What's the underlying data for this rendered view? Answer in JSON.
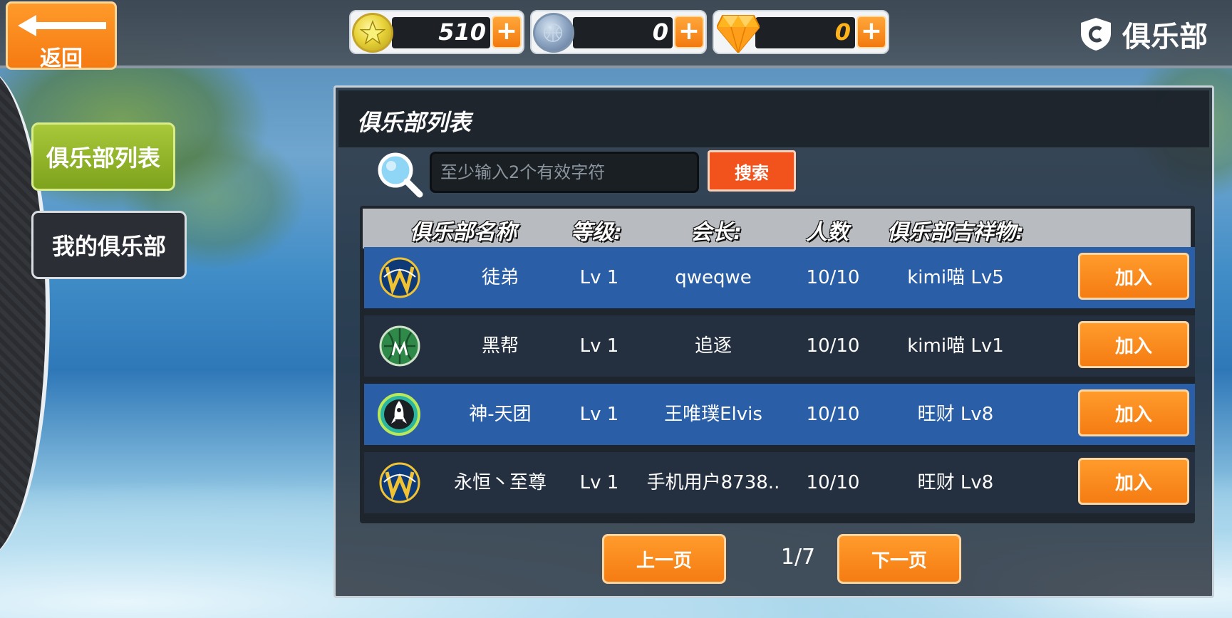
{
  "header": {
    "back_label": "返回",
    "title": "俱乐部",
    "currencies": [
      {
        "type": "gold-coin",
        "value": "510"
      },
      {
        "type": "silver-coin",
        "value": "0"
      },
      {
        "type": "diamond",
        "value": "0"
      }
    ],
    "plus_label": "+"
  },
  "sidebar": {
    "items": [
      {
        "label": "俱乐部列表",
        "active": true
      },
      {
        "label": "我的俱乐部",
        "active": false
      }
    ]
  },
  "panel": {
    "title": "俱乐部列表",
    "search": {
      "placeholder": "至少输入2个有效字符",
      "button_label": "搜索"
    },
    "columns": [
      "俱乐部名称",
      "等级:",
      "会长:",
      "人数",
      "俱乐部吉祥物:"
    ],
    "rows": [
      {
        "logo": "wizards-logo",
        "name": "徒弟",
        "level": "Lv 1",
        "leader": "qweqwe",
        "members": "10/10",
        "mascot": "kimi喵 Lv5",
        "action": "加入"
      },
      {
        "logo": "bucks-logo",
        "name": "黑帮",
        "level": "Lv 1",
        "leader": "追逐",
        "members": "10/10",
        "mascot": "kimi喵 Lv1",
        "action": "加入"
      },
      {
        "logo": "rockets-logo",
        "name": "神-天团",
        "level": "Lv 1",
        "leader": "王唯璞Elvis",
        "members": "10/10",
        "mascot": "旺财 Lv8",
        "action": "加入"
      },
      {
        "logo": "wizards-logo",
        "name": "永恒丶至尊",
        "level": "Lv 1",
        "leader": "手机用户8738..",
        "members": "10/10",
        "mascot": "旺财 Lv8",
        "action": "加入"
      }
    ],
    "pagination": {
      "prev_label": "上一页",
      "next_label": "下一页",
      "indicator": "1/7"
    }
  },
  "colors": {
    "accent_orange": "#f57c12",
    "row_blue": "#2a5ea6",
    "row_dark": "#243040",
    "active_tab_green": "#7da21c",
    "search_button": "#f2531c"
  }
}
